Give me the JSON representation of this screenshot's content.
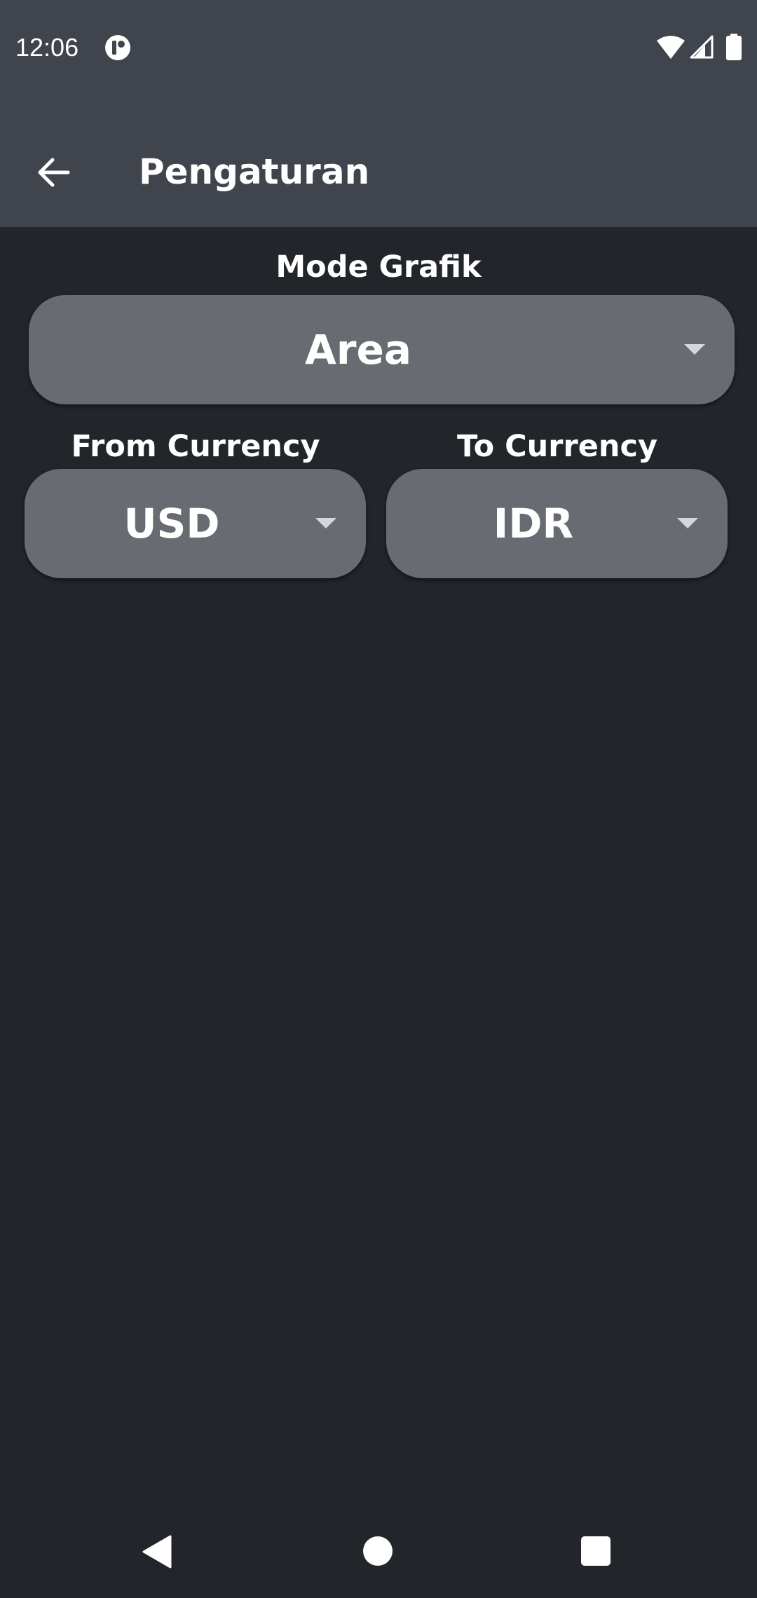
{
  "status_bar": {
    "time": "12:06",
    "icons": [
      "app-notification-icon",
      "wifi-icon",
      "cell-signal-icon",
      "battery-icon"
    ]
  },
  "toolbar": {
    "back_icon": "arrow-left-icon",
    "title": "Pengaturan"
  },
  "settings": {
    "mode_label": "Mode Grafik",
    "mode_value": "Area",
    "from_label": "From Currency",
    "from_value": "USD",
    "to_label": "To Currency",
    "to_value": "IDR"
  },
  "nav_bar": {
    "icons": [
      "nav-back-icon",
      "nav-home-icon",
      "nav-recents-icon"
    ]
  },
  "colors": {
    "app_bar": "#40444c",
    "background": "#22252a",
    "spinner": "#686b71",
    "text": "#ffffff"
  }
}
